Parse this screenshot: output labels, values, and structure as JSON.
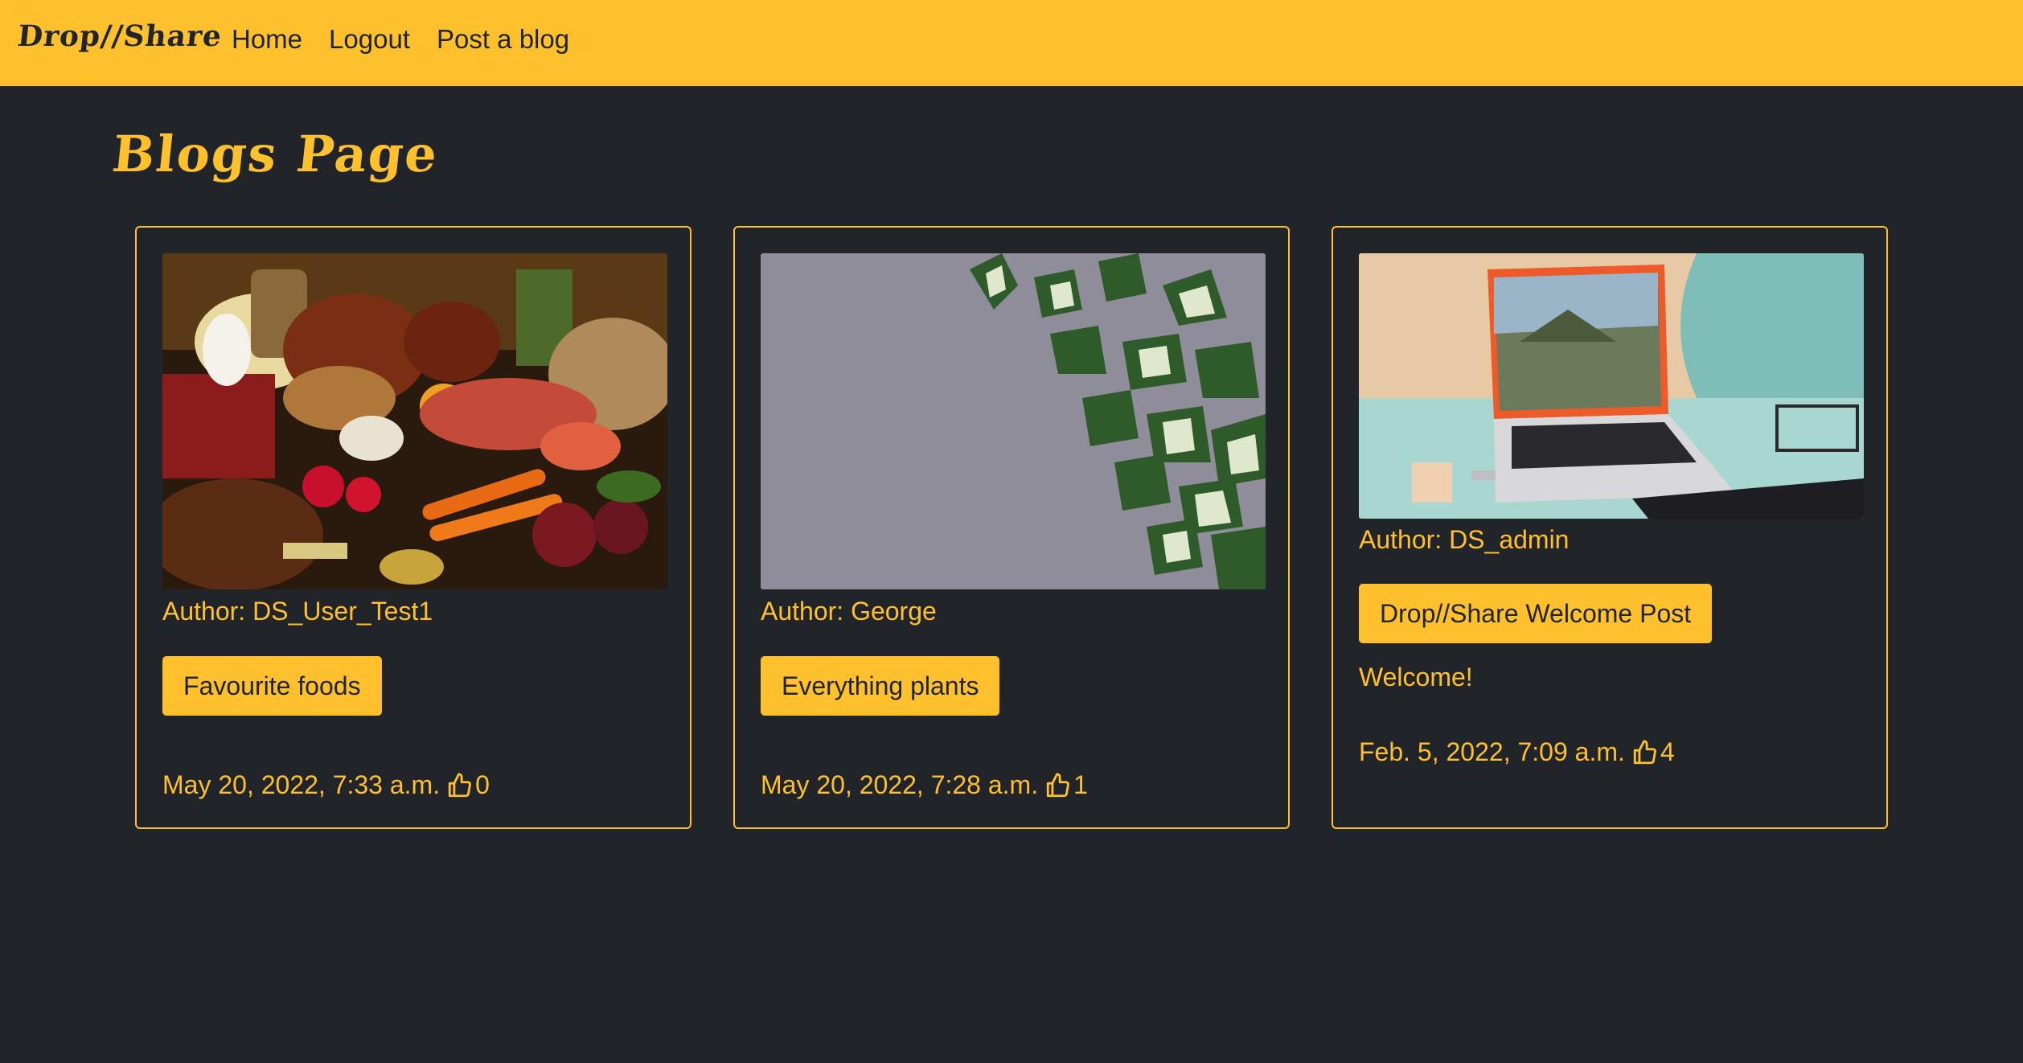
{
  "nav": {
    "brand": "Drop//Share",
    "links": [
      "Home",
      "Logout",
      "Post a blog"
    ]
  },
  "page": {
    "title": "Blogs Page"
  },
  "posts": [
    {
      "author": "Author: DS_User_Test1",
      "title": "Favourite foods",
      "excerpt": "",
      "date": "May 20, 2022, 7:33 a.m.",
      "likes": "0",
      "image_icon": "food-photo"
    },
    {
      "author": "Author: George",
      "title": "Everything plants",
      "excerpt": "",
      "date": "May 20, 2022, 7:28 a.m.",
      "likes": "1",
      "image_icon": "ivy-wall-photo"
    },
    {
      "author": "Author: DS_admin",
      "title": "Drop//Share Welcome Post",
      "excerpt": "Welcome!",
      "date": "Feb. 5, 2022, 7:09 a.m.",
      "likes": "4",
      "image_icon": "laptop-desk-photo"
    }
  ],
  "colors": {
    "accent": "#ffc02e",
    "background": "#212529"
  }
}
